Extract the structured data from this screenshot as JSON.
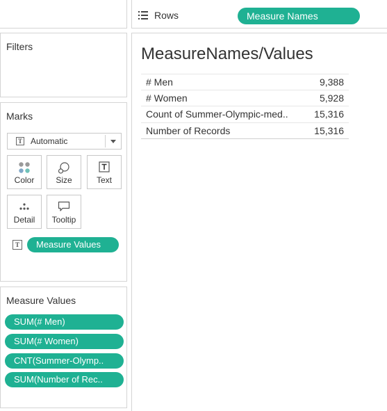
{
  "shelves": {
    "rows_label": "Rows",
    "rows_pill": "Measure Names"
  },
  "filters": {
    "title": "Filters"
  },
  "marks": {
    "title": "Marks",
    "mark_type": "Automatic",
    "buttons": [
      {
        "label": "Color",
        "icon": "color-dots-icon"
      },
      {
        "label": "Size",
        "icon": "size-icon"
      },
      {
        "label": "Text",
        "icon": "text-icon"
      },
      {
        "label": "Detail",
        "icon": "detail-dots-icon"
      },
      {
        "label": "Tooltip",
        "icon": "tooltip-icon"
      }
    ],
    "text_pill": "Measure Values"
  },
  "measure_values": {
    "title": "Measure Values",
    "pills": [
      "SUM(# Men)",
      "SUM(# Women)",
      "CNT(Summer-Olymp..",
      "SUM(Number of Rec.."
    ]
  },
  "view": {
    "title": "MeasureNames/Values",
    "rows": [
      {
        "name": "# Men",
        "value": "9,388"
      },
      {
        "name": "# Women",
        "value": "5,928"
      },
      {
        "name": "Count of Summer-Olympic-med..",
        "value": "15,316"
      },
      {
        "name": "Number of Records",
        "value": "15,316"
      }
    ]
  },
  "colors": {
    "pill": "#1fb193",
    "border": "#d4d4d4",
    "text": "#333333"
  }
}
